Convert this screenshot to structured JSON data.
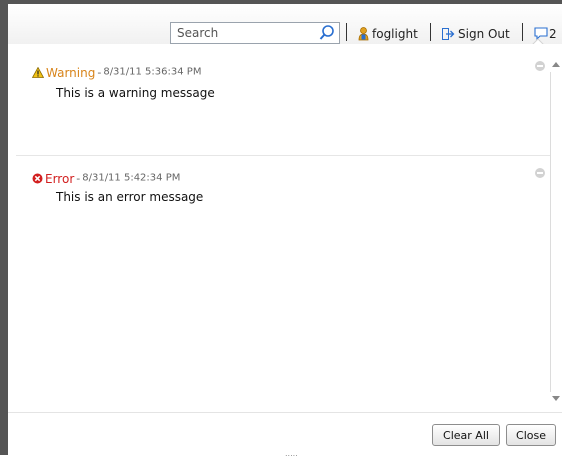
{
  "header": {
    "search_placeholder": "Search",
    "username": "foglight",
    "sign_out_label": "Sign Out",
    "message_count": "2"
  },
  "messages": [
    {
      "severity": "Warning",
      "timestamp": "8/31/11 5:36:34 PM",
      "text": "This is a warning message",
      "color": "#d8841a",
      "icon": "warning-icon"
    },
    {
      "severity": "Error",
      "timestamp": "8/31/11 5:42:34 PM",
      "text": "This is an error message",
      "color": "#d21f1f",
      "icon": "error-icon"
    }
  ],
  "footer": {
    "clear_all_label": "Clear All",
    "close_label": "Close",
    "resize_grip": "....."
  },
  "colors": {
    "user_icon": "#e0a020",
    "link_blue": "#2a6fd0",
    "frame": "#555555"
  }
}
